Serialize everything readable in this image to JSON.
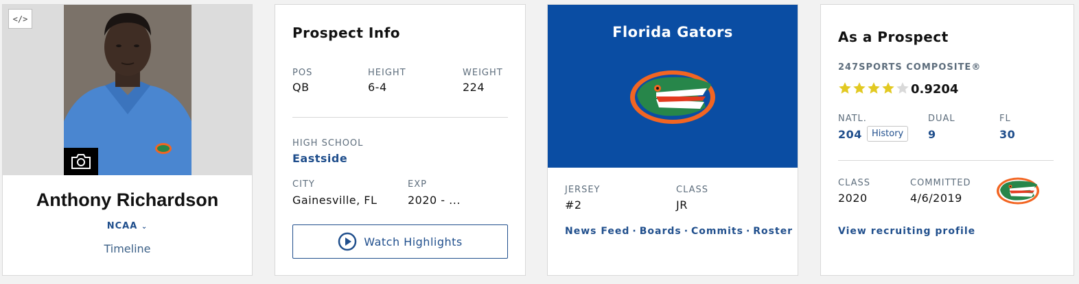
{
  "player": {
    "name": "Anthony Richardson",
    "league": "NCAA",
    "timeline": "Timeline",
    "embed_label": "</>"
  },
  "prospect_info": {
    "title": "Prospect Info",
    "pos_label": "POS",
    "pos": "QB",
    "height_label": "HEIGHT",
    "height": "6-4",
    "weight_label": "WEIGHT",
    "weight": "224",
    "high_school_label": "HIGH SCHOOL",
    "high_school": "Eastside",
    "city_label": "CITY",
    "city": "Gainesville, FL",
    "exp_label": "EXP",
    "exp": "2020 - ...",
    "watch_label": "Watch Highlights"
  },
  "team": {
    "name": "Florida Gators",
    "jersey_label": "JERSEY",
    "jersey": "#2",
    "class_label": "CLASS",
    "class": "JR",
    "links": [
      "News Feed",
      "Boards",
      "Commits",
      "Roster"
    ],
    "link_separator": "·"
  },
  "as_prospect": {
    "title": "As a Prospect",
    "composite_label": "247SPORTS COMPOSITE®",
    "stars_filled": 4,
    "stars_total": 5,
    "rating": "0.9204",
    "natl_label": "NATL.",
    "natl": "204",
    "history_label": "History",
    "dual_label": "DUAL",
    "dual": "9",
    "fl_label": "FL",
    "fl": "30",
    "class_label": "CLASS",
    "class": "2020",
    "committed_label": "COMMITTED",
    "committed": "4/6/2019",
    "view_link": "View recruiting profile"
  },
  "colors": {
    "accent": "#1f4e8c",
    "team_blue": "#0a4da3",
    "gator_orange": "#f26522",
    "gator_green": "#27864a",
    "star_gold": "#e2c922",
    "star_empty": "#d9d9d9"
  }
}
